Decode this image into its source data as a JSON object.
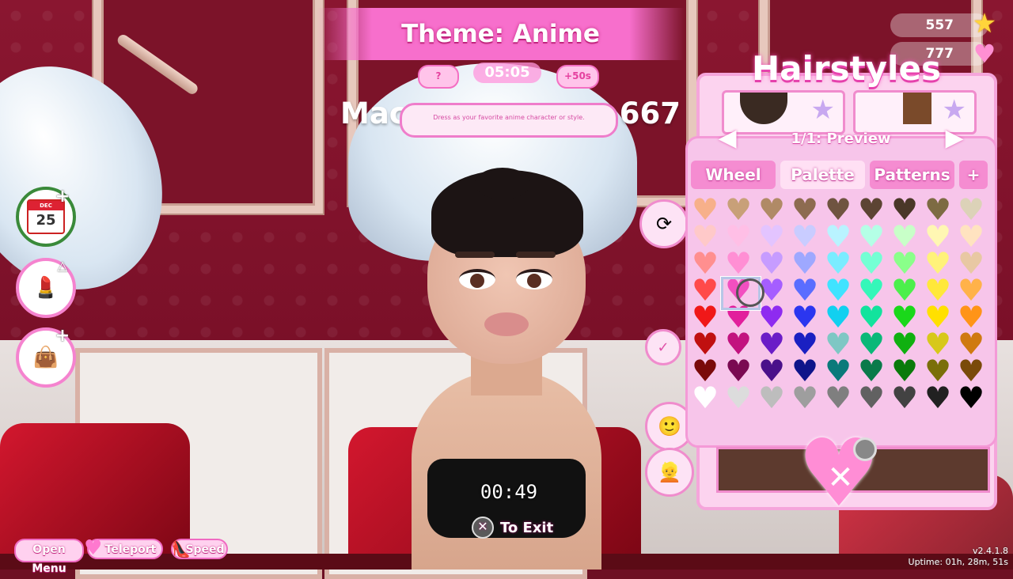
{
  "theme": {
    "label": "Theme: Anime"
  },
  "round_timer": "05:05",
  "hud": {
    "outfit_badge": "?",
    "bonus_badge": "+50s"
  },
  "model_name": {
    "left": "Mac",
    "right": "667"
  },
  "prompt": "Dress as your favorite anime character or style.",
  "currency": {
    "stars": "557",
    "hearts": "777"
  },
  "calendar": {
    "month": "DEC",
    "day": "25"
  },
  "hairstyles": {
    "title": "Hairstyles",
    "preview_label": "1/1: Preview",
    "tabs": [
      "Wheel",
      "Palette",
      "Patterns",
      "+"
    ],
    "active_tab": "Palette",
    "palette": [
      [
        "#f7b08a",
        "#c8a078",
        "#b08a66",
        "#8d6b50",
        "#6f5440",
        "#5c4433",
        "#4a3728",
        "#7d6b43",
        "#dcd2b8"
      ],
      [
        "#ffc9c9",
        "#ffbfe6",
        "#e3c4ff",
        "#c9ccff",
        "#b9f3ff",
        "#b4ffe6",
        "#c8ffc8",
        "#fff7b3",
        "#ffe3c0"
      ],
      [
        "#ff8f8f",
        "#ff8fd4",
        "#c69cff",
        "#9ea8ff",
        "#7aecff",
        "#74ffd4",
        "#8aff8a",
        "#fff27a",
        "#e8c8a3"
      ],
      [
        "#ff4a4a",
        "#f24fc0",
        "#a55eff",
        "#5a6dff",
        "#3fe3ff",
        "#35f7b9",
        "#4cef4c",
        "#ffe83a",
        "#ffb24a"
      ],
      [
        "#f01818",
        "#e21f9c",
        "#8e2bf0",
        "#2b36f0",
        "#12d0f0",
        "#12e39d",
        "#1ad81a",
        "#ffe000",
        "#ff9418"
      ],
      [
        "#c01010",
        "#c2127f",
        "#6a1cc7",
        "#1a20c2",
        "#7ec7c4",
        "#0ab878",
        "#10b010",
        "#d7c81a",
        "#cf7a10"
      ],
      [
        "#7a0a0a",
        "#7a0a52",
        "#4a108a",
        "#0e148a",
        "#0a7a7a",
        "#0a7a4a",
        "#0a7a0a",
        "#7a6f0a",
        "#7a4a0a"
      ],
      [
        "#ffffff",
        "#dcdcdc",
        "#bdbdbd",
        "#9e9e9e",
        "#7f7f7f",
        "#616161",
        "#424242",
        "#212121",
        "#000000"
      ]
    ],
    "selected_swatch": "row 4 col 2"
  },
  "timer_mid": "00:49",
  "exit_hint": "To Exit",
  "controls": {
    "open_menu": "Open Menu",
    "teleport": "Teleport",
    "speed": "Speed"
  },
  "version": {
    "line1": "v2.4.1.8",
    "line2": "Uptime: 01h, 28m, 51s"
  }
}
